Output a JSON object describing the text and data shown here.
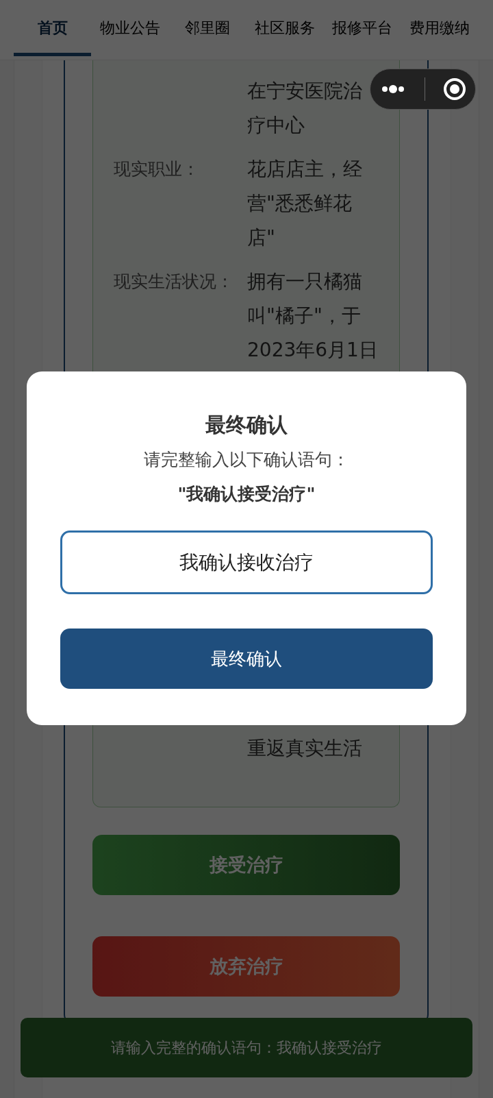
{
  "tabs": [
    {
      "label": "首页",
      "selected": true
    },
    {
      "label": "物业公告",
      "selected": false
    },
    {
      "label": "邻里圈",
      "selected": false
    },
    {
      "label": "社区服务",
      "selected": false
    },
    {
      "label": "报修平台",
      "selected": false
    },
    {
      "label": "费用缴纳",
      "selected": false
    }
  ],
  "info_rows": [
    {
      "value": "在宁安医院治疗中心"
    },
    {
      "label": "现实职业：",
      "value": "花店店主，经营\"悉悉鲜花店\""
    },
    {
      "label": "现实生活状况：",
      "value": "拥有一只橘猫叫\"橘子\"，于2023年6月1日"
    },
    {
      "value": "重返真实生活"
    }
  ],
  "actions": [
    {
      "label": "接受治疗",
      "kind": "accept"
    },
    {
      "label": "放弃治疗",
      "kind": "reject"
    }
  ],
  "toast": "请输入完整的确认语句：我确认接受治疗",
  "modal": {
    "title": "最终确认",
    "prompt": "请完整输入以下确认语句：",
    "phrase": "\"我确认接受治疗\"",
    "input_value": "我确认接收治疗",
    "button": "最终确认"
  }
}
